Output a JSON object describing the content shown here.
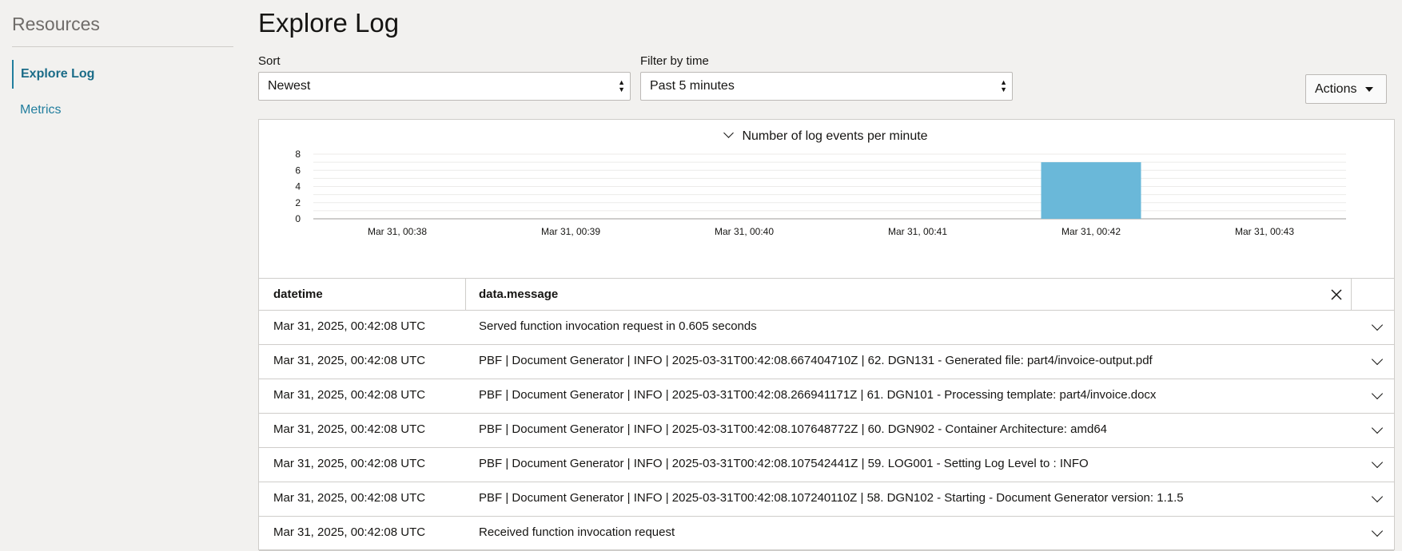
{
  "sidebar": {
    "title": "Resources",
    "items": [
      {
        "label": "Explore Log"
      },
      {
        "label": "Metrics"
      }
    ]
  },
  "main": {
    "title": "Explore Log",
    "sort": {
      "label": "Sort",
      "value": "Newest"
    },
    "filter": {
      "label": "Filter by time",
      "value": "Past 5 minutes"
    },
    "actions_label": "Actions"
  },
  "chart_data": {
    "type": "bar",
    "title": "Number of log events per minute",
    "categories": [
      "Mar 31, 00:38",
      "Mar 31, 00:39",
      "Mar 31, 00:40",
      "Mar 31, 00:41",
      "Mar 31, 00:42",
      "Mar 31, 00:43"
    ],
    "values": [
      0,
      0,
      0,
      0,
      7,
      0
    ],
    "yticks": [
      0,
      2,
      4,
      6,
      8
    ],
    "ylim": [
      0,
      8
    ],
    "grid": true,
    "bar_color": "#6ab8d9"
  },
  "table": {
    "columns": [
      "datetime",
      "data.message"
    ],
    "rows": [
      {
        "datetime": "Mar 31, 2025, 00:42:08 UTC",
        "message": "Served function invocation request in 0.605 seconds"
      },
      {
        "datetime": "Mar 31, 2025, 00:42:08 UTC",
        "message": "PBF | Document Generator | INFO | 2025-03-31T00:42:08.667404710Z | 62. DGN131 - Generated file: part4/invoice-output.pdf"
      },
      {
        "datetime": "Mar 31, 2025, 00:42:08 UTC",
        "message": "PBF | Document Generator | INFO | 2025-03-31T00:42:08.266941171Z | 61. DGN101 - Processing template: part4/invoice.docx"
      },
      {
        "datetime": "Mar 31, 2025, 00:42:08 UTC",
        "message": "PBF | Document Generator | INFO | 2025-03-31T00:42:08.107648772Z | 60. DGN902 - Container Architecture: amd64"
      },
      {
        "datetime": "Mar 31, 2025, 00:42:08 UTC",
        "message": "PBF | Document Generator | INFO | 2025-03-31T00:42:08.107542441Z | 59. LOG001 - Setting Log Level to : INFO"
      },
      {
        "datetime": "Mar 31, 2025, 00:42:08 UTC",
        "message": "PBF | Document Generator | INFO | 2025-03-31T00:42:08.107240110Z | 58. DGN102 - Starting - Document Generator version: 1.1.5"
      },
      {
        "datetime": "Mar 31, 2025, 00:42:08 UTC",
        "message": "Received function invocation request"
      }
    ]
  },
  "colors": {
    "accent": "#227e9e",
    "background": "#f2f1ef"
  }
}
